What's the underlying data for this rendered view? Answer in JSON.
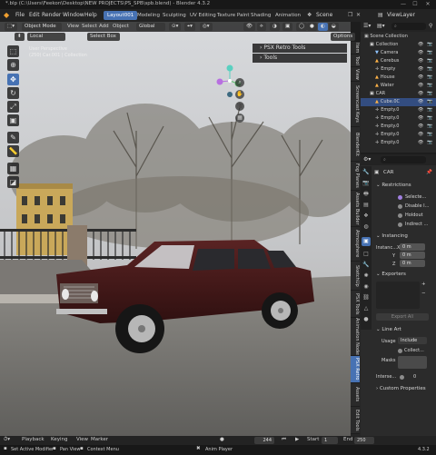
{
  "window": {
    "title": "*.blp (C:\\Users\\Feekon\\Desktop\\NEW PROJECTS\\PS_SPB\\spb.blend) - Blender 4.3.2",
    "minimize": "—",
    "maximize": "☐",
    "close": "✕"
  },
  "menubar": {
    "logo": "◆",
    "items": [
      "File",
      "Edit",
      "Render",
      "Window",
      "Help"
    ],
    "workspaces": [
      "Layout001",
      "Modeling",
      "Sculpting",
      "UV Editing",
      "Texture Paint",
      "Shading",
      "Animation"
    ],
    "active_workspace": "Layout001",
    "scene_label": "Scene",
    "viewlayer_label": "ViewLayer"
  },
  "viewport_header": {
    "mode": "Object Mode",
    "menus": [
      "View",
      "Select",
      "Add",
      "Object"
    ],
    "orientation": "Global",
    "transform_orientation": "Local",
    "select_mode": "Select Box",
    "options": "Options",
    "overlay_text_1": "User Perspective",
    "overlay_text_2": "(250) Car.001 | Collection"
  },
  "viewport_panels": {
    "psx": "PSX Retro Tools",
    "tools": "Tools"
  },
  "sidebar_tabs": [
    "Item",
    "Tool",
    "View",
    "Screencast Keys",
    "BlenderKit",
    "Fog Planes",
    "Assets Builder",
    "Atmosphere",
    "SketchUp",
    "PSX Tools",
    "Animation Nodes",
    "PSX Retro",
    "Assets",
    "Edit Tools"
  ],
  "active_sidebar_tab": "PSX Retro",
  "outliner": {
    "search_placeholder": "",
    "root": "Scene Collection",
    "rows": [
      {
        "label": "Collection",
        "indent": 1,
        "icon": "▣",
        "color": "#e0e0e0"
      },
      {
        "label": "Camera",
        "indent": 2,
        "icon": "▼",
        "color": "#8fc3ff"
      },
      {
        "label": "Cerebus",
        "indent": 2,
        "icon": "▲",
        "color": "#ffb347"
      },
      {
        "label": "Empty",
        "indent": 2,
        "icon": "✛",
        "color": "#d0d0d0"
      },
      {
        "label": "House",
        "indent": 2,
        "icon": "▲",
        "color": "#ffb347"
      },
      {
        "label": "Water",
        "indent": 2,
        "icon": "▲",
        "color": "#ffb347"
      },
      {
        "label": "CAR",
        "indent": 1,
        "icon": "▣",
        "color": "#e0e0e0"
      },
      {
        "label": "Cube.0C",
        "indent": 2,
        "icon": "▲",
        "color": "#ffb347",
        "selected": true
      },
      {
        "label": "Empty.0",
        "indent": 2,
        "icon": "✛",
        "color": "#d0d0d0"
      },
      {
        "label": "Empty.0",
        "indent": 2,
        "icon": "✛",
        "color": "#d0d0d0"
      },
      {
        "label": "Empty.0",
        "indent": 2,
        "icon": "✛",
        "color": "#d0d0d0"
      },
      {
        "label": "Empty.0",
        "indent": 2,
        "icon": "✛",
        "color": "#d0d0d0"
      },
      {
        "label": "Empty.0",
        "indent": 2,
        "icon": "✛",
        "color": "#d0d0d0"
      }
    ]
  },
  "properties": {
    "object_name": "CAR",
    "restrictions": {
      "title": "Restrictions",
      "items": [
        "Selecte...",
        "Disable I...",
        "Holdout",
        "Indirect ..."
      ]
    },
    "instancing": {
      "title": "Instancing",
      "fields": [
        {
          "label": "Instanc...X",
          "value": "0 m"
        },
        {
          "label": "Y",
          "value": "0 m"
        },
        {
          "label": "Z",
          "value": "0 m"
        }
      ]
    },
    "exporters": {
      "title": "Exporters",
      "button": "Export All"
    },
    "line_art": {
      "title": "Line Art",
      "usage_label": "Usage",
      "usage_value": "Include",
      "collect_label": "Collect...",
      "masks_label": "Masks",
      "intersect_label": "Interse...",
      "intersect_value": "0"
    },
    "custom_props": "Custom Properties"
  },
  "timeline": {
    "menus": [
      "Playback",
      "Keying",
      "View",
      "Marker"
    ],
    "current_frame": "244",
    "start_label": "Start",
    "start_value": "1",
    "end_label": "End",
    "end_value": "250"
  },
  "statusbar": {
    "hint_1": "Set Active Modifier",
    "hint_2": "Pan View",
    "hint_3": "Context Menu",
    "center": "Anim Player",
    "version": "4.3.2"
  },
  "colors": {
    "accent": "#4772b3",
    "sky": "#c9ccd0",
    "car_body": "#4a1c1c",
    "ground": "#8d8b86"
  }
}
